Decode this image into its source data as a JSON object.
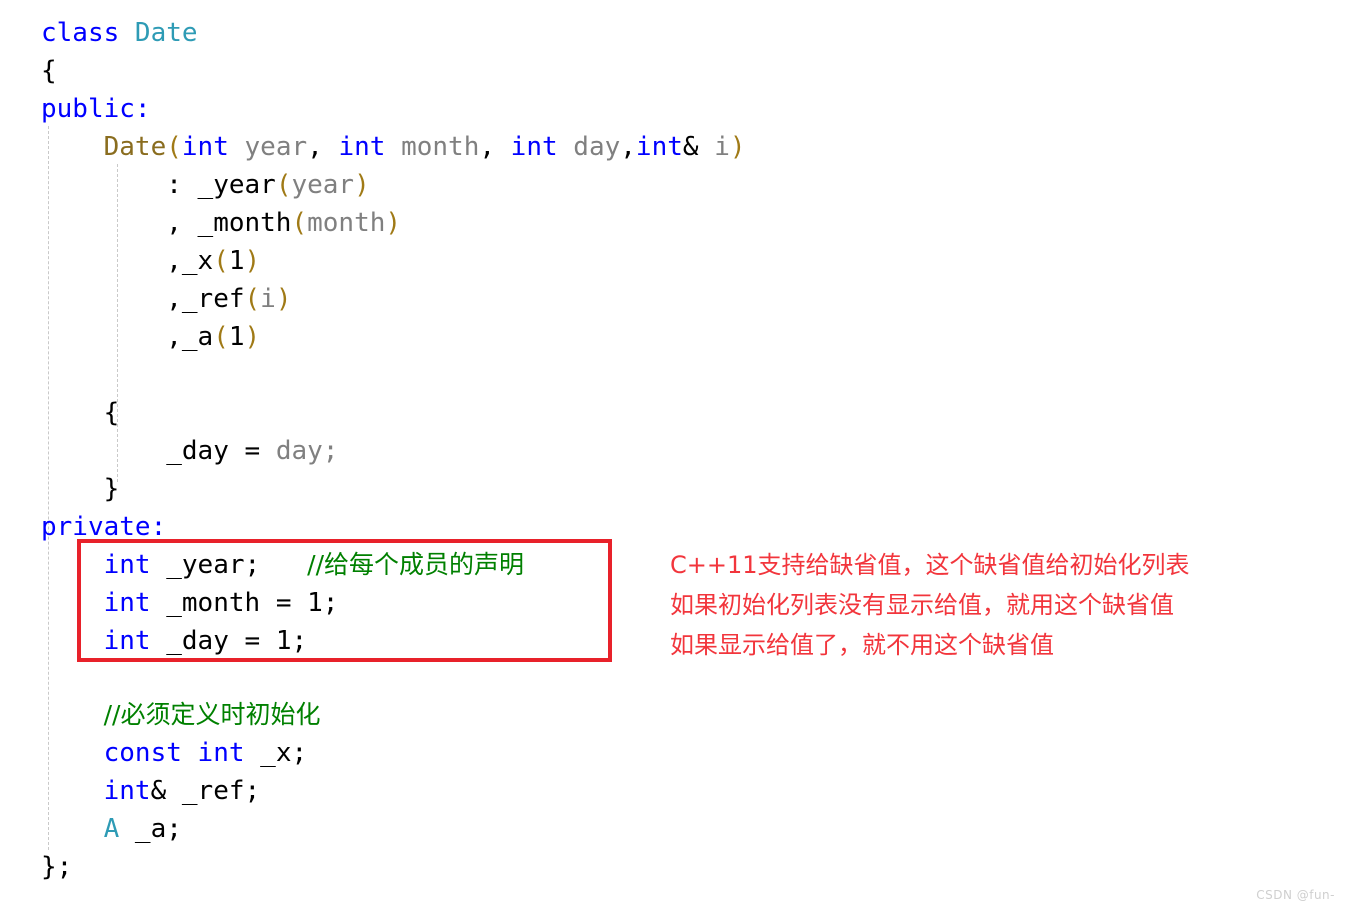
{
  "editor": {
    "language": "cpp",
    "background_color": "#ffffff",
    "font_size_px": 26,
    "line_height_px": 38
  },
  "colors": {
    "keyword": "#0000ff",
    "type_name": "#2e9bb5",
    "function_name": "#8a6d1f",
    "paren": "#a07a16",
    "parameter": "#808080",
    "plain_text": "#000000",
    "comment_green": "#008000",
    "annotation_red": "#f2353c",
    "highlight_box_red": "#e8212a",
    "indent_guide": "#c9c9c9",
    "watermark": "#cfcfcf"
  },
  "code": {
    "l01_class": "class ",
    "l01_name": "Date",
    "l02_brace": "{",
    "l03_public": "public:",
    "l04_indent": "    ",
    "l04_fn": "Date",
    "l04_open": "(",
    "l04_int1": "int",
    "l04_p1": " year",
    "l04_c1": ", ",
    "l04_int2": "int",
    "l04_p2": " month",
    "l04_c2": ", ",
    "l04_int3": "int",
    "l04_p3": " day",
    "l04_c3": ",",
    "l04_int4": "int",
    "l04_amp": "& ",
    "l04_p4": "i",
    "l04_close": ")",
    "l05_indent": "        ",
    "l05_colon": ": _year",
    "l05_open": "(",
    "l05_arg": "year",
    "l05_close": ")",
    "l06_indent": "        ",
    "l06_comma": ", _month",
    "l06_open": "(",
    "l06_arg": "month",
    "l06_close": ")",
    "l07_indent": "        ",
    "l07_comma": ",_x",
    "l07_open": "(",
    "l07_arg": "1",
    "l07_close": ")",
    "l08_indent": "        ",
    "l08_comma": ",_ref",
    "l08_open": "(",
    "l08_arg": "i",
    "l08_close": ")",
    "l09_indent": "        ",
    "l09_comma": ",_a",
    "l09_open": "(",
    "l09_arg": "1",
    "l09_close": ")",
    "l11_brace": "    {",
    "l12_indent": "        ",
    "l12_lhs": "_day = ",
    "l12_rhs": "day",
    "l12_semi": ";",
    "l13_brace": "    }",
    "l14_private": "private:",
    "l15_indent": "    ",
    "l15_kw": "int",
    "l15_name": " _year;   ",
    "l15_comment": "//给每个成员的声明",
    "l16_indent": "    ",
    "l16_kw": "int",
    "l16_rest": " _month = 1;",
    "l17_indent": "    ",
    "l17_kw": "int",
    "l17_rest": " _day = 1;",
    "l19_indent": "    ",
    "l19_comment": "//必须定义时初始化",
    "l20_indent": "    ",
    "l20_kw": "const int",
    "l20_rest": " _x;",
    "l21_indent": "    ",
    "l21_kw": "int",
    "l21_rest": "& _ref;",
    "l22_indent": "    ",
    "l22_type": "A",
    "l22_rest": " _a;",
    "l23_end": "};"
  },
  "annotation": {
    "line1": "C++11支持给缺省值，这个缺省值给初始化列表",
    "line2": "如果初始化列表没有显示给值，就用这个缺省值",
    "line3": "如果显示给值了，就不用这个缺省值"
  },
  "watermark": {
    "text": "CSDN @fun-"
  }
}
